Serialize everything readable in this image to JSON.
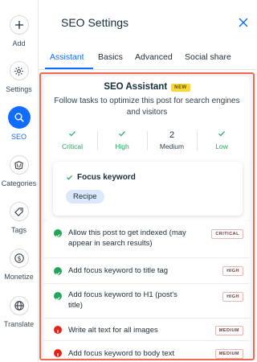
{
  "rail": {
    "items": [
      {
        "label": "Add",
        "icon": "plus-icon"
      },
      {
        "label": "Settings",
        "icon": "gear-icon"
      },
      {
        "label": "SEO",
        "icon": "search-icon",
        "active": true
      },
      {
        "label": "Categories",
        "icon": "categories-icon"
      },
      {
        "label": "Tags",
        "icon": "tag-icon"
      },
      {
        "label": "Monetize",
        "icon": "dollar-icon"
      },
      {
        "label": "Translate",
        "icon": "globe-icon"
      }
    ]
  },
  "panel": {
    "title": "SEO Settings",
    "tabs": [
      {
        "label": "Assistant",
        "active": true
      },
      {
        "label": "Basics"
      },
      {
        "label": "Advanced"
      },
      {
        "label": "Social share"
      }
    ]
  },
  "assistant": {
    "title": "SEO Assistant",
    "badge": "NEW",
    "description": "Follow tasks to optimize this post for search engines and visitors",
    "stats": [
      {
        "value": "✓",
        "label": "Critical"
      },
      {
        "value": "✓",
        "label": "High"
      },
      {
        "value": "2",
        "label": "Medium"
      },
      {
        "value": "✓",
        "label": "Low"
      }
    ],
    "focus": {
      "title": "Focus keyword",
      "keyword": "Recipe"
    }
  },
  "tasks": [
    {
      "text": "Allow this post to get indexed (may appear in search results)",
      "badge": "CRITICAL",
      "status": "done"
    },
    {
      "text": "Add focus keyword to title tag",
      "badge": "HIGH",
      "status": "done"
    },
    {
      "text": "Add focus keyword to H1 (post's title)",
      "badge": "HIGH",
      "status": "done"
    },
    {
      "text": "Write alt text for all images",
      "badge": "MEDIUM",
      "status": "todo"
    },
    {
      "text": "Add focus keyword to body text",
      "badge": "MEDIUM",
      "status": "todo"
    }
  ],
  "colors": {
    "accent": "#116dff",
    "success": "#25a55a",
    "error": "#e62214",
    "highlight_border": "#f06a4f",
    "new_badge": "#fdd835"
  }
}
